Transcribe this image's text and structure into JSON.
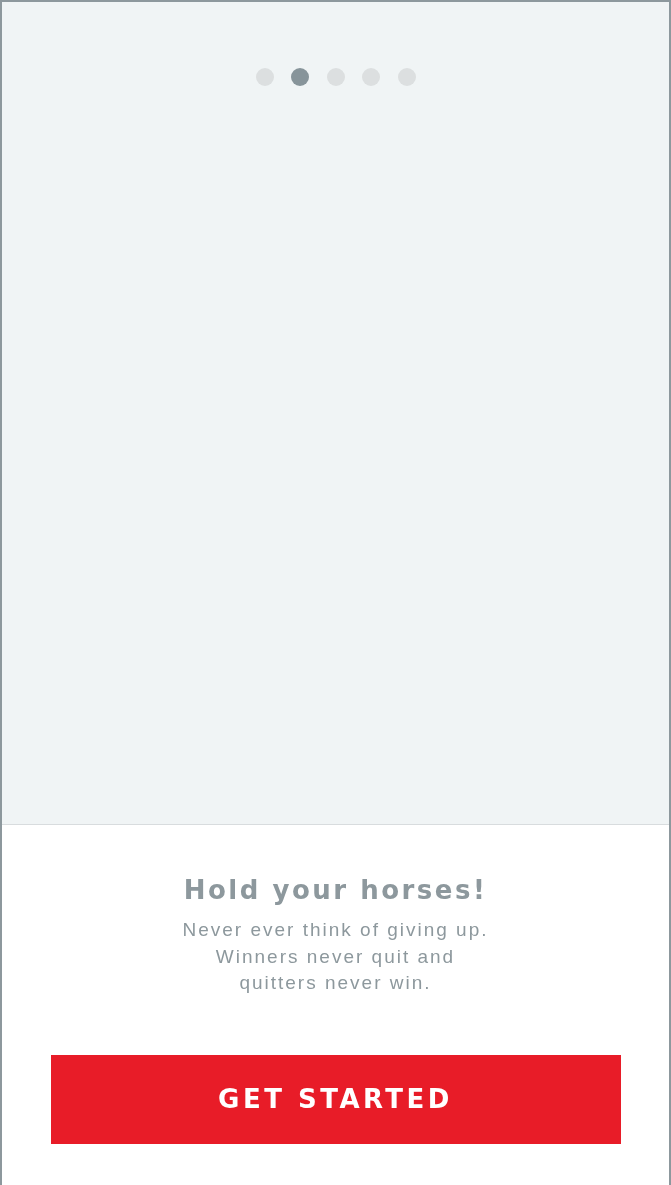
{
  "pager": {
    "dots": [
      {
        "selected": false
      },
      {
        "selected": true
      },
      {
        "selected": false
      },
      {
        "selected": false
      },
      {
        "selected": false
      }
    ]
  },
  "title": "Hold your horses!",
  "message": "Never ever think of giving up.\nWinners never quit and\nquitters never win.",
  "button": "GET STARTED"
}
